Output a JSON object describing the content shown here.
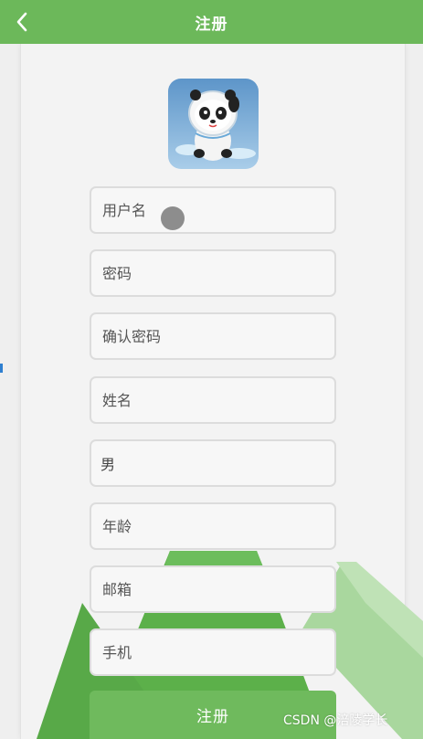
{
  "header": {
    "title": "注册"
  },
  "form": {
    "username_placeholder": "用户名",
    "password_placeholder": "密码",
    "confirm_password_placeholder": "确认密码",
    "name_placeholder": "姓名",
    "gender_value": "男",
    "age_placeholder": "年龄",
    "email_placeholder": "邮箱",
    "phone_placeholder": "手机",
    "submit_label": "注册"
  },
  "watermark": "CSDN @涪陵学长",
  "colors": {
    "primary_green": "#6cb85a",
    "field_border": "#dcdcdc",
    "background": "#efefef"
  }
}
